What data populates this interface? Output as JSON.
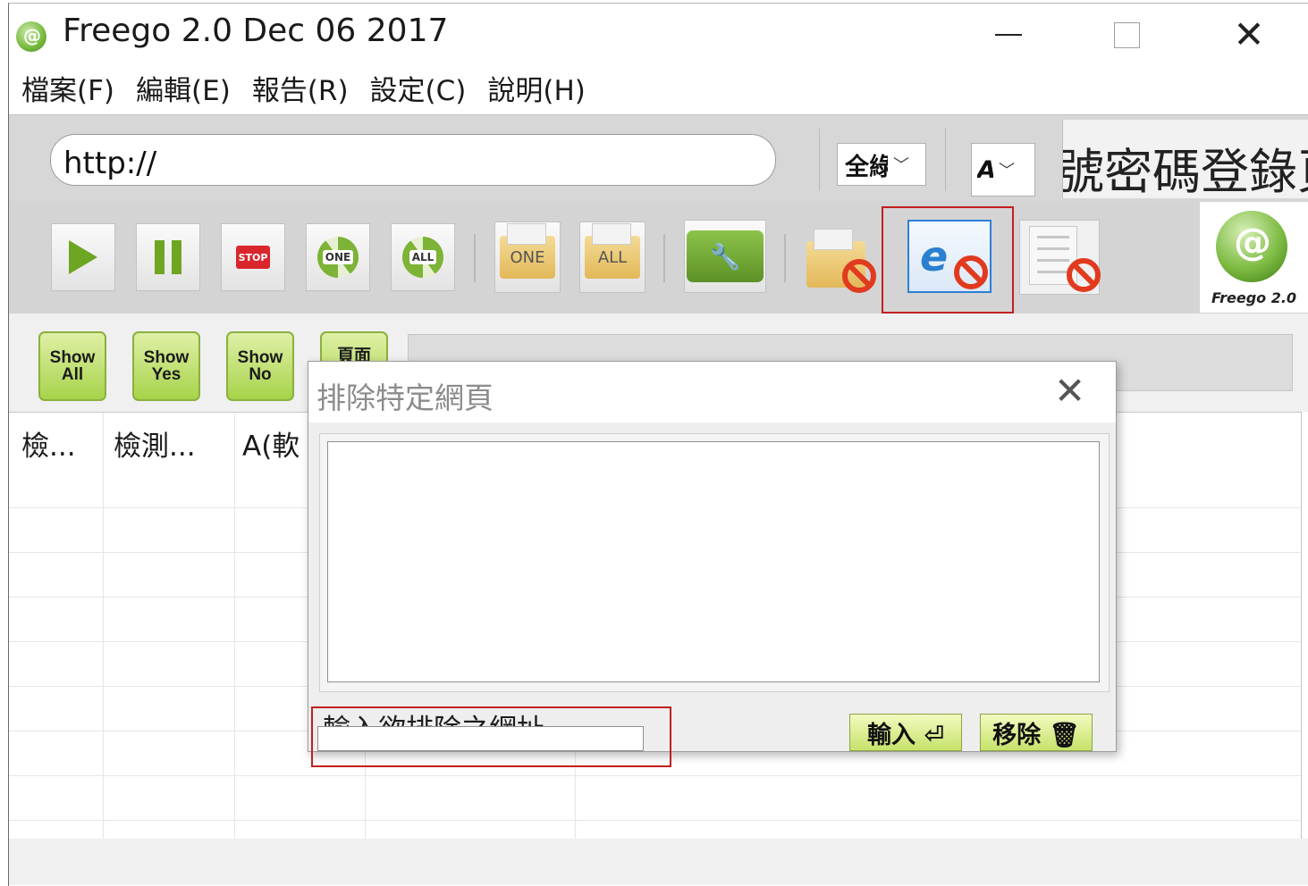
{
  "window": {
    "title": "Freego 2.0 Dec 06 2017",
    "icon": "freego-app-icon",
    "controls": [
      "minimize",
      "maximize",
      "close"
    ]
  },
  "menu": [
    "檔案(F)",
    "編輯(E)",
    "報告(R)",
    "設定(C)",
    "說明(H)"
  ],
  "url_bar": {
    "value": "http://",
    "scope_combo": "全綠",
    "level_combo": "A",
    "banner_text": "帳號密碼登錄頁"
  },
  "toolbar": {
    "buttons": [
      {
        "name": "start",
        "icon": "play-icon"
      },
      {
        "name": "pause",
        "icon": "pause-icon"
      },
      {
        "name": "stop",
        "icon": "stop-icon",
        "label": "STOP"
      },
      {
        "name": "recheck-one",
        "icon": "refresh-icon",
        "label": "ONE"
      },
      {
        "name": "recheck-all",
        "icon": "refresh-icon",
        "label": "ALL"
      },
      {
        "name": "open-one",
        "icon": "folder-icon",
        "label": "ONE"
      },
      {
        "name": "open-all",
        "icon": "folder-icon",
        "label": "ALL"
      },
      {
        "name": "settings",
        "icon": "toolbox-icon"
      },
      {
        "name": "exclude-folder",
        "icon": "folder-ban-icon"
      },
      {
        "name": "exclude-webpage",
        "icon": "ie-ban-icon",
        "selected": true
      },
      {
        "name": "exclude-document",
        "icon": "document-ban-icon"
      }
    ],
    "logo_text": "Freego 2.0"
  },
  "filters": [
    {
      "line1": "Show",
      "line2": "All"
    },
    {
      "line1": "Show",
      "line2": "Yes"
    },
    {
      "line1": "Show",
      "line2": "No"
    },
    {
      "line1": "頁面",
      "line2": ""
    }
  ],
  "table": {
    "columns": [
      "檢...",
      "檢測...",
      "A(軟"
    ]
  },
  "dialog": {
    "title": "排除特定網頁",
    "input_label": "輸入欲排除之網址",
    "input_value": "",
    "add_button": "輸入 ⏎",
    "remove_button": "移除 🗑"
  },
  "colors": {
    "accent_green": "#a7d34a",
    "highlight_red": "#c21f1f",
    "selected_blue": "#2e7fd6"
  }
}
